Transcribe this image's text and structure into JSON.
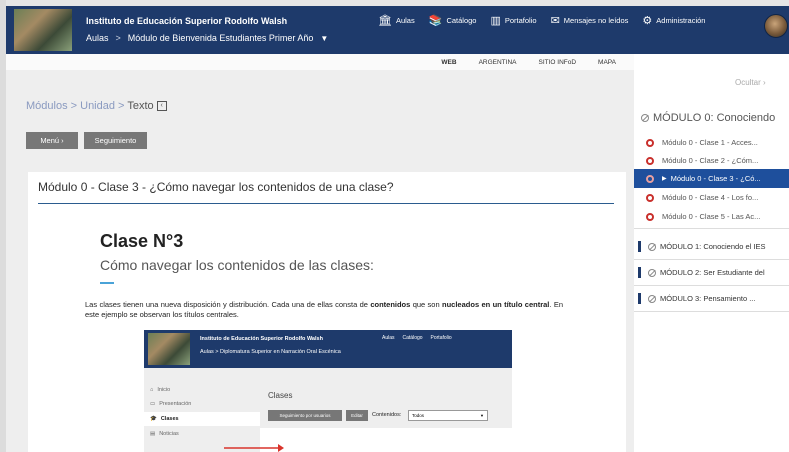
{
  "header": {
    "institution": "Instituto de Educación Superior Rodolfo Walsh",
    "crumbs": [
      "Aulas",
      "Módulo de Bienvenida Estudiantes Primer Año"
    ],
    "nav": [
      {
        "icon": "building-icon",
        "label": "Aulas"
      },
      {
        "icon": "book-icon",
        "label": "Catálogo"
      },
      {
        "icon": "portfolio-icon",
        "label": "Portafolio"
      },
      {
        "icon": "envelope-icon",
        "label": "Mensajes no leídos"
      },
      {
        "icon": "gear-icon",
        "label": "Administración"
      }
    ]
  },
  "linkbar": [
    "WEB",
    "ARGENTINA",
    "SITIO INFoD",
    "MAPA"
  ],
  "breadcrumb": {
    "a": "Módulos",
    "b": "Unidad",
    "c": "Texto"
  },
  "buttons": {
    "menu": "Menú",
    "seguimiento": "Seguimiento"
  },
  "card": {
    "title": "Módulo 0 - Clase 3 - ¿Cómo navegar los contenidos de una clase?",
    "heading": "Clase N°3",
    "subheading": "Cómo navegar los contenidos de las clases:",
    "p_text1": "Las clases tienen una nueva disposición y distribución. Cada una de ellas consta de ",
    "p_bold1": "contenidos",
    "p_text2": " que son ",
    "p_bold2": "nucleados en un título central",
    "p_text3": ". En este ejemplo se observan los títulos centrales."
  },
  "embedded": {
    "institution": "Instituto de Educación Superior Rodolfo Walsh",
    "crumbs": "Aulas  >  Diplomatura Superior en Narración Oral Escénica",
    "nav": [
      "Aulas",
      "Catálogo",
      "Portafolio"
    ],
    "sidebar": [
      "Inicio",
      "Presentación",
      "Clases",
      "Noticias"
    ],
    "section": "Clases",
    "btn_seg": "Seguimiento por usuarios",
    "btn_edit": "Editar",
    "contenidos_label": "Contenidos:",
    "select_value": "Todos"
  },
  "right": {
    "hide": "Ocultar",
    "section": "MÓDULO 0: Conociendo",
    "lessons": [
      "Módulo 0 - Clase 1 - Acces...",
      "Módulo 0 - Clase 2 - ¿Cóm...",
      "Módulo 0 - Clase 3 - ¿Có...",
      "Módulo 0 - Clase 4 - Los fo...",
      "Módulo 0 - Clase 5 - Las Ac..."
    ],
    "modules": [
      "MÓDULO 1: Conociendo el IES",
      "MÓDULO 2: Ser Estudiante del",
      "MÓDULO 3: Pensamiento ..."
    ]
  },
  "colors": {
    "header": "#1e3a6b",
    "active": "#1e4f9c",
    "ring": "#c9302c"
  }
}
